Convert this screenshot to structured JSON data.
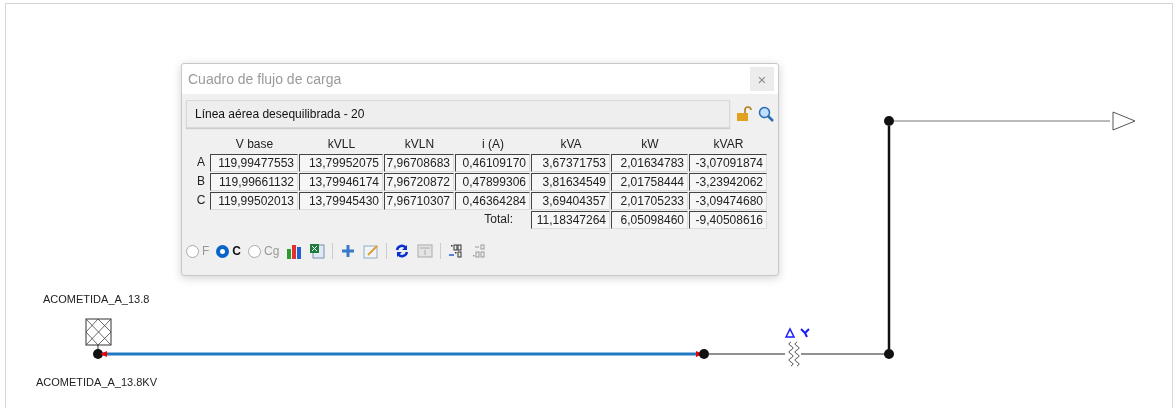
{
  "diagram": {
    "source_label": "ACOMETIDA_A_13.8",
    "bus_label": "ACOMETIDA_A_13.8KV"
  },
  "dialog": {
    "title": "Cuadro de flujo de carga",
    "close": "×",
    "element": "Línea aérea desequilibrada - 20",
    "columns": [
      "V base",
      "kVLL",
      "kVLN",
      "i (A)",
      "kVA",
      "kW",
      "kVAR"
    ],
    "rows": [
      {
        "phase": "A",
        "values": [
          "119,99477553",
          "13,79952075",
          "7,96708683",
          "0,46109170",
          "3,67371753",
          "2,01634783",
          "-3,07091874"
        ]
      },
      {
        "phase": "B",
        "values": [
          "119,99661132",
          "13,79946174",
          "7,96720872",
          "0,47899306",
          "3,81634549",
          "2,01758444",
          "-3,23942062"
        ]
      },
      {
        "phase": "C",
        "values": [
          "119,99502013",
          "13,79945430",
          "7,96710307",
          "0,46364284",
          "3,69404357",
          "2,01705233",
          "-3,09474680"
        ]
      }
    ],
    "total": {
      "label": "Total:",
      "values": [
        "11,18347264",
        "6,05098460",
        "-9,40508616"
      ]
    },
    "modes": [
      {
        "label": "F",
        "selected": false
      },
      {
        "label": "C",
        "selected": true
      },
      {
        "label": "Cg",
        "selected": false
      }
    ]
  }
}
